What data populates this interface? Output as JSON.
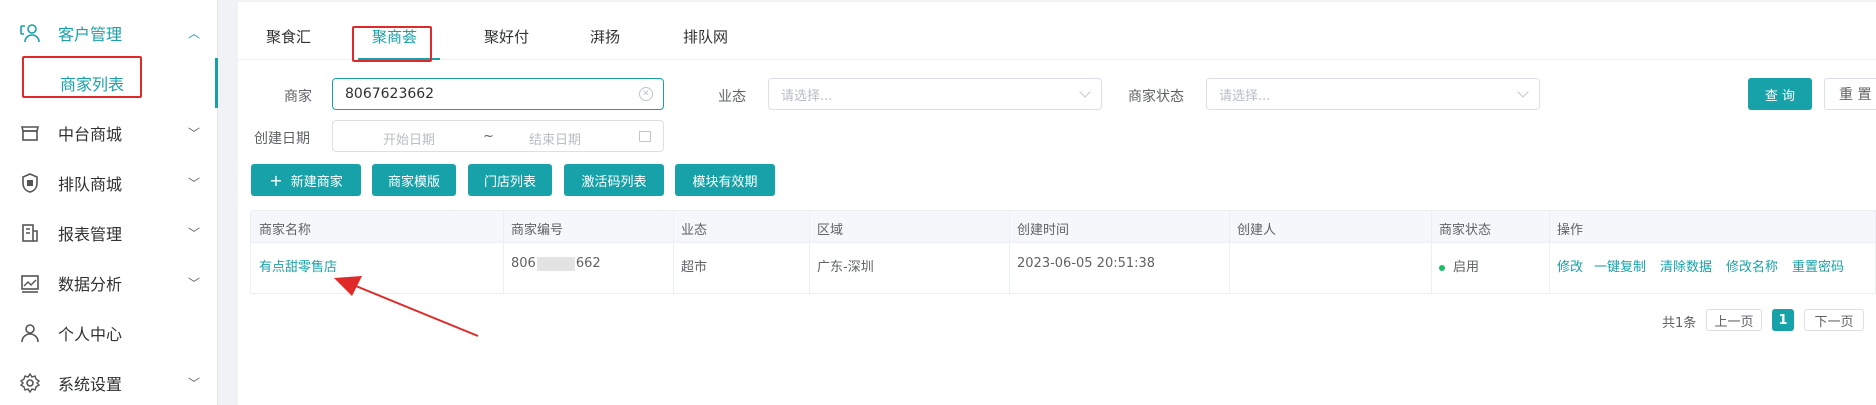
{
  "sidebar": {
    "items": [
      {
        "label": "客户管理",
        "icon": "user-group-icon"
      },
      {
        "label": "中台商城",
        "icon": "store-icon"
      },
      {
        "label": "排队商城",
        "icon": "shield-icon"
      },
      {
        "label": "报表管理",
        "icon": "report-icon"
      },
      {
        "label": "数据分析",
        "icon": "chart-icon"
      },
      {
        "label": "个人中心",
        "icon": "person-icon"
      },
      {
        "label": "系统设置",
        "icon": "gear-icon"
      }
    ],
    "sub_active": "商家列表"
  },
  "tabs": [
    "聚食汇",
    "聚商荟",
    "聚好付",
    "湃扬",
    "排队网"
  ],
  "filters": {
    "merchant_label": "商家",
    "merchant_value": "8067623662",
    "industry_label": "业态",
    "industry_placeholder": "请选择...",
    "status_label": "商家状态",
    "status_placeholder": "请选择...",
    "created_label": "创建日期",
    "start_placeholder": "开始日期",
    "range_sep": "~",
    "end_placeholder": "结束日期",
    "query": "查 询",
    "reset": "重 置"
  },
  "actions": {
    "new_merchant": "新建商家",
    "merchant_template": "商家模版",
    "store_list": "门店列表",
    "activation_codes": "激活码列表",
    "module_validity": "模块有效期"
  },
  "table": {
    "headers": [
      "商家名称",
      "商家编号",
      "业态",
      "区域",
      "创建时间",
      "创建人",
      "商家状态",
      "操作"
    ],
    "row": {
      "name": "有点甜零售店",
      "code_prefix": "806",
      "code_suffix": "662",
      "industry": "超市",
      "region": "广东-深圳",
      "created": "2023-06-05 20:51:38",
      "creator": "",
      "status": "启用",
      "ops": [
        "修改",
        "一键复制",
        "清除数据",
        "修改名称",
        "重置密码"
      ]
    }
  },
  "pager": {
    "total": "共1条",
    "prev": "上一页",
    "current": "1",
    "next": "下一页"
  },
  "colors": {
    "accent": "#17a2a9",
    "annotation": "#e02a2a",
    "status_on": "#19be6b"
  }
}
